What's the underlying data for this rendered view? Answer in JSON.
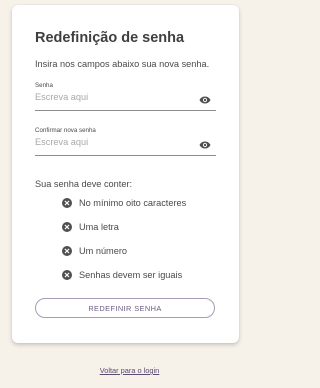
{
  "page": {
    "title": "Redefinição de senha",
    "subtitle": "Insira nos campos abaixo sua nova senha."
  },
  "form": {
    "password": {
      "label": "Senha",
      "placeholder": "Escreva aqui",
      "value": "",
      "toggle_icon": "eye-icon"
    },
    "confirm_password": {
      "label": "Confirmar nova senha",
      "placeholder": "Escreva aqui",
      "value": "",
      "toggle_icon": "eye-icon"
    }
  },
  "requirements": {
    "title": "Sua senha deve conter:",
    "status_icon": "x-circle-icon",
    "items": [
      {
        "label": "No mínimo oito caracteres"
      },
      {
        "label": "Uma letra"
      },
      {
        "label": "Um número"
      },
      {
        "label": "Senhas devem ser iguais"
      }
    ]
  },
  "actions": {
    "submit_label": "REDEFINIR SENHA",
    "back_link_label": "Voltar para o login"
  },
  "colors": {
    "background": "#f6f1e9",
    "card": "#ffffff",
    "accent": "#6e5b85",
    "text": "#4a4a4a",
    "icon": "#4f4f4f"
  }
}
